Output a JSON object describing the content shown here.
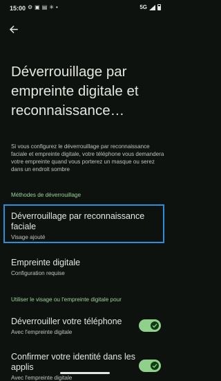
{
  "status_bar": {
    "time": "15:00",
    "network": "5G"
  },
  "page": {
    "title": "Déverrouillage par empreinte digitale et reconnaissance…",
    "description": "Si vous configurez le déverrouillage par reconnaissance faciale et empreinte digitale, votre téléphone vous demandera votre empreinte quand vous porterez un masque ou serez dans un endroit sombre"
  },
  "methods": {
    "header": "Méthodes de déverrouillage",
    "items": [
      {
        "title": "Déverrouillage par reconnaissance faciale",
        "summary": "Visage ajouté"
      },
      {
        "title": "Empreinte digitale",
        "summary": "Configuration requise"
      }
    ]
  },
  "usage": {
    "header": "Utiliser le visage ou l'empreinte digitale pour",
    "items": [
      {
        "title": "Déverrouiller votre téléphone",
        "summary": "Avec l'empreinte digitale",
        "enabled": true
      },
      {
        "title": "Confirmer votre identité dans les applis",
        "summary": "Avec l'empreinte digitale",
        "enabled": true
      }
    ]
  },
  "colors": {
    "background": "#0d120f",
    "accent": "#8fd18a",
    "focus": "#2c8fda"
  }
}
